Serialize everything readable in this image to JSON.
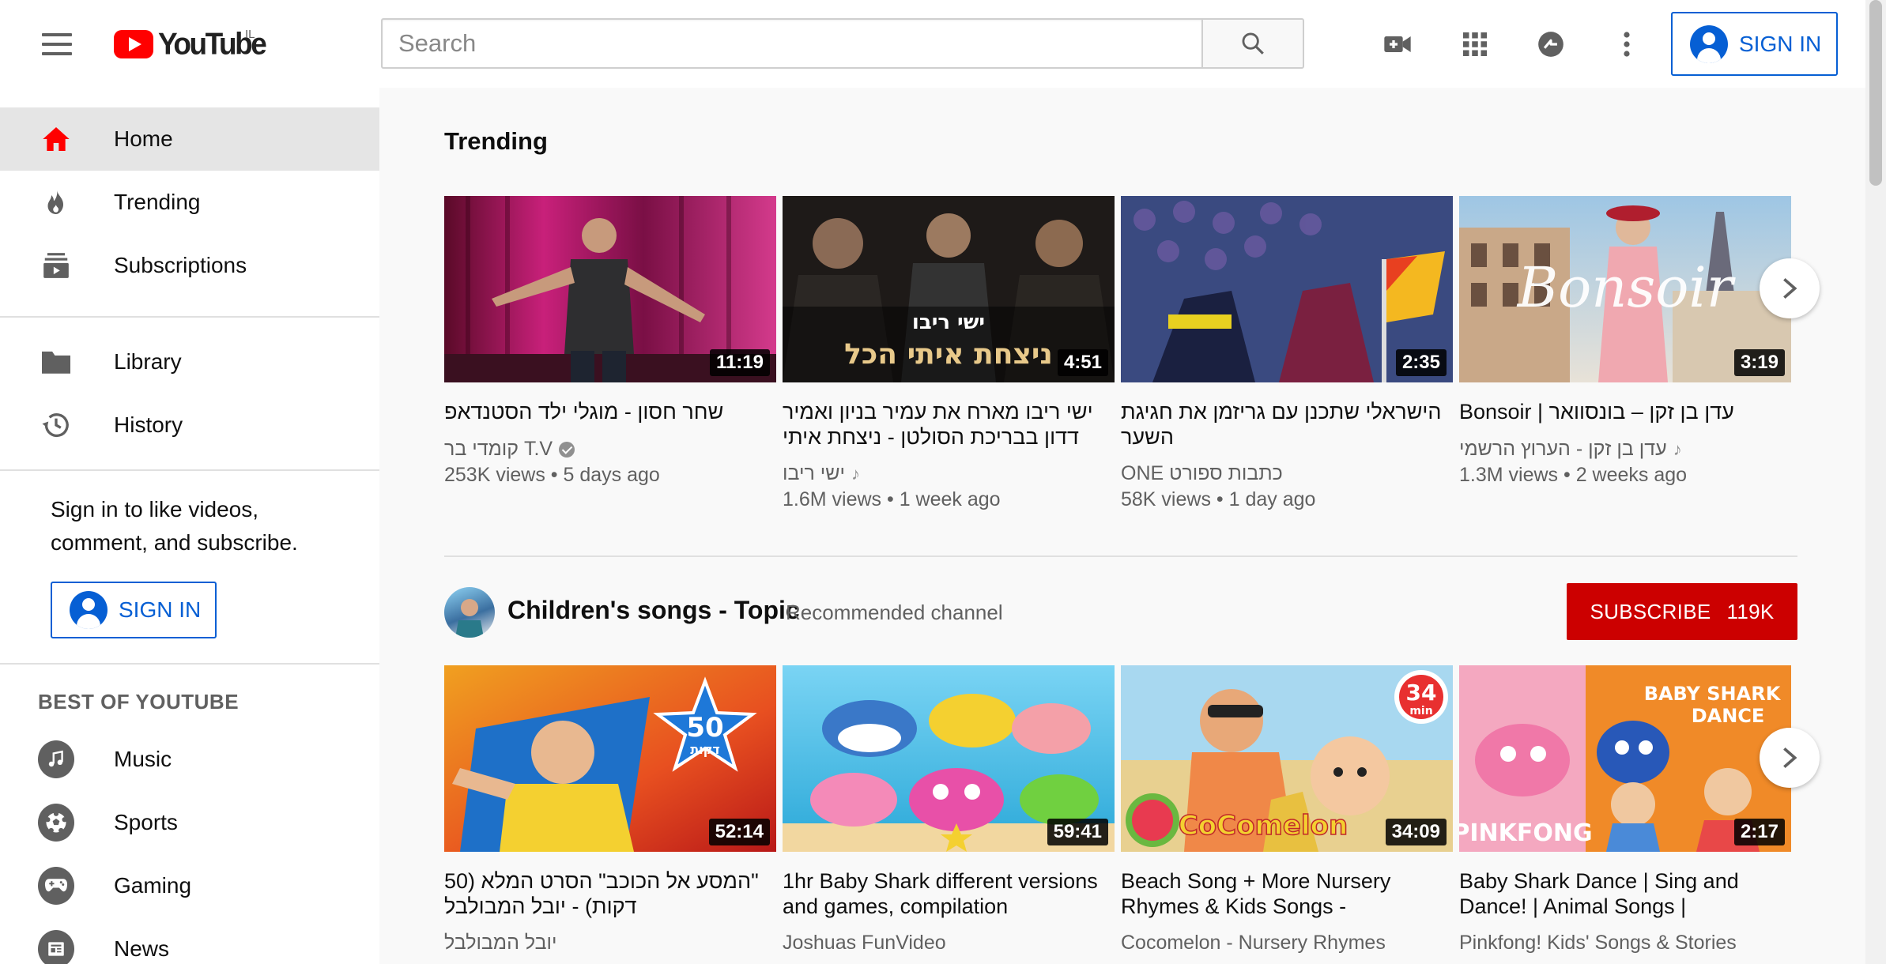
{
  "header": {
    "logo_text": "YouTube",
    "country_code": "IL",
    "search_placeholder": "Search",
    "signin_label": "SIGN IN"
  },
  "sidebar": {
    "primary": [
      {
        "label": "Home",
        "icon": "home-icon",
        "active": true
      },
      {
        "label": "Trending",
        "icon": "trending-icon"
      },
      {
        "label": "Subscriptions",
        "icon": "subscriptions-icon"
      }
    ],
    "secondary": [
      {
        "label": "Library",
        "icon": "library-icon"
      },
      {
        "label": "History",
        "icon": "history-icon"
      }
    ],
    "signin_note": "Sign in to like videos, comment, and subscribe.",
    "signin_label": "SIGN IN",
    "best_heading": "BEST OF YOUTUBE",
    "best": [
      {
        "label": "Music",
        "icon": "music-icon"
      },
      {
        "label": "Sports",
        "icon": "sports-icon"
      },
      {
        "label": "Gaming",
        "icon": "gaming-icon"
      },
      {
        "label": "News",
        "icon": "news-icon"
      }
    ]
  },
  "trending": {
    "title": "Trending",
    "videos": [
      {
        "title": "שחר חסון - מוגלי ילד הסטנדאפ",
        "channel": "קומדי בר T.V",
        "verified": true,
        "music": false,
        "views": "253K views",
        "age": "5 days ago",
        "duration": "11:19"
      },
      {
        "title": "ישי ריבו מארח את עמיר בניון ואמיר דדון בבריכת הסולטן - ניצחת איתי הכל",
        "channel": "ישי ריבו",
        "verified": false,
        "music": true,
        "views": "1.6M views",
        "age": "1 week ago",
        "duration": "4:51"
      },
      {
        "title": "הישראלי שתכנן עם גריזמן את חגיגת השער",
        "channel": "ONE כתבות ספורט",
        "verified": false,
        "music": false,
        "views": "58K views",
        "age": "1 day ago",
        "duration": "2:35"
      },
      {
        "title": "עדן בן זקן – בונסוואר | Bonsoir",
        "channel": "עדן בן זקן - הערוץ הרשמי",
        "verified": false,
        "music": true,
        "views": "1.3M views",
        "age": "2 weeks ago",
        "duration": "3:19"
      }
    ]
  },
  "recommended": {
    "channel_name": "Children's songs - Topic",
    "tag": "Recommended channel",
    "subscribe_label": "SUBSCRIBE",
    "subscriber_count": "119K",
    "videos": [
      {
        "title": "\"המסע אל הכוכב\" הסרט המלא (50 דקות) - יובל המבולבל",
        "channel": "יובל המבולבל",
        "duration": "52:14"
      },
      {
        "title": "1hr Baby Shark different versions and games, compilation",
        "channel": "Joshuas FunVideo",
        "duration": "59:41"
      },
      {
        "title": "Beach Song + More Nursery Rhymes & Kids Songs - CoCoMelon",
        "channel": "Cocomelon - Nursery Rhymes",
        "duration": "34:09"
      },
      {
        "title": "Baby Shark Dance | Sing and Dance! | Animal Songs | PINKFONG Songs for Children",
        "channel": "Pinkfong! Kids' Songs & Stories",
        "duration": "2:17"
      }
    ]
  },
  "thumb_text": {
    "t2_line1": "ישי ריבו",
    "t2_line2": "ניצחת איתי הכל",
    "t4_script": "Bonsoir",
    "r1_badge_num": "50",
    "r1_badge_word": "דקות",
    "r3_badge_num": "34",
    "r3_badge_unit": "min",
    "r3_brand": "CoComelon",
    "r4_top": "BABY SHARK",
    "r4_top2": "DANCE",
    "r4_brand": "PINKFONG"
  },
  "colors": {
    "brand_red": "#ff0000",
    "link_blue": "#065fd4",
    "subscribe_red": "#cc0000"
  }
}
